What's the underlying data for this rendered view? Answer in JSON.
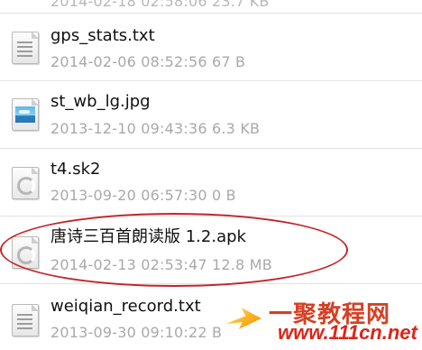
{
  "top_partial": {
    "text": "2014-02-18 02:58:06 23.7 KB"
  },
  "files": [
    {
      "name": "gps_stats.txt",
      "meta": "2014-02-06 08:52:56  67 B",
      "icon": "text-file-icon"
    },
    {
      "name": "st_wb_lg.jpg",
      "meta": "2013-12-10 09:43:36  6.3 KB",
      "icon": "image-file-icon"
    },
    {
      "name": "t4.sk2",
      "meta": "2013-09-20 06:57:30  0 B",
      "icon": "generic-file-icon"
    },
    {
      "name": "唐诗三百首朗读版 1.2.apk",
      "meta": "2014-02-13 02:53:47  12.8 MB",
      "icon": "generic-file-icon"
    },
    {
      "name": "weiqian_record.txt",
      "meta": "2013-09-30 09:10:22  B",
      "icon": "text-file-icon"
    }
  ],
  "watermark": {
    "main": "一聚教程网",
    "sub": "www.111cn.net"
  },
  "colors": {
    "divider": "#e2e2e2",
    "meta_text": "#a9a9a9",
    "highlight": "#c3242a",
    "watermark": "#d44024"
  }
}
